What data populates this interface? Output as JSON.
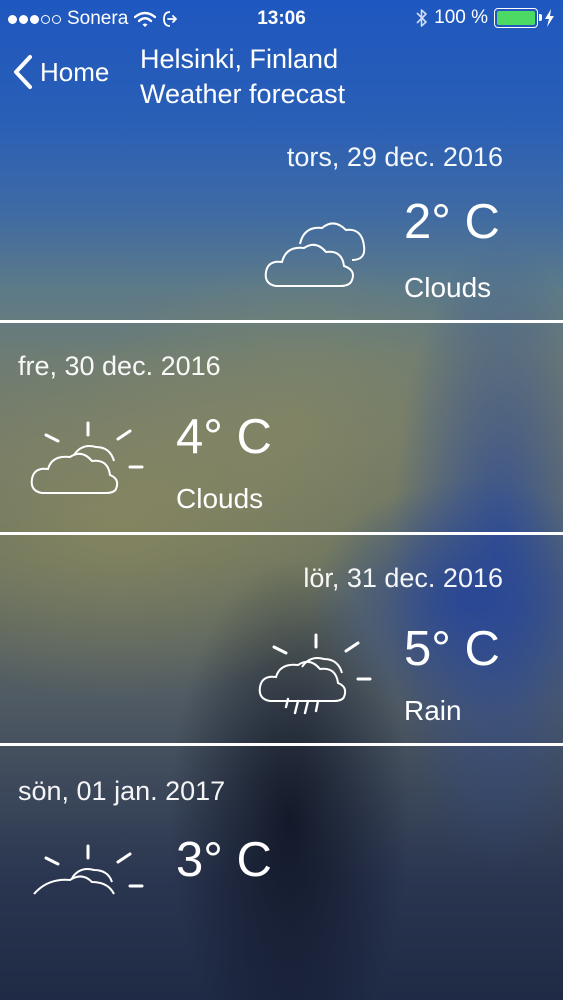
{
  "status_bar": {
    "carrier": "Sonera",
    "time": "13:06",
    "battery": "100 %",
    "battery_level": 1.0,
    "battery_color": "#4cd964"
  },
  "nav": {
    "back_label": "Home",
    "title_line1": "Helsinki, Finland",
    "title_line2": "Weather forecast"
  },
  "forecast": [
    {
      "date": "tors, 29 dec. 2016",
      "temp": "2° C",
      "condition": "Clouds",
      "icon": "clouds-icon"
    },
    {
      "date": "fre, 30 dec. 2016",
      "temp": "4° C",
      "condition": "Clouds",
      "icon": "partly-cloudy-icon"
    },
    {
      "date": "lör, 31 dec. 2016",
      "temp": "5° C",
      "condition": "Rain",
      "icon": "rain-sun-icon"
    },
    {
      "date": "sön, 01 jan. 2017",
      "temp": "3° C",
      "condition": "",
      "icon": "sun-cloud-horizon-icon"
    }
  ]
}
